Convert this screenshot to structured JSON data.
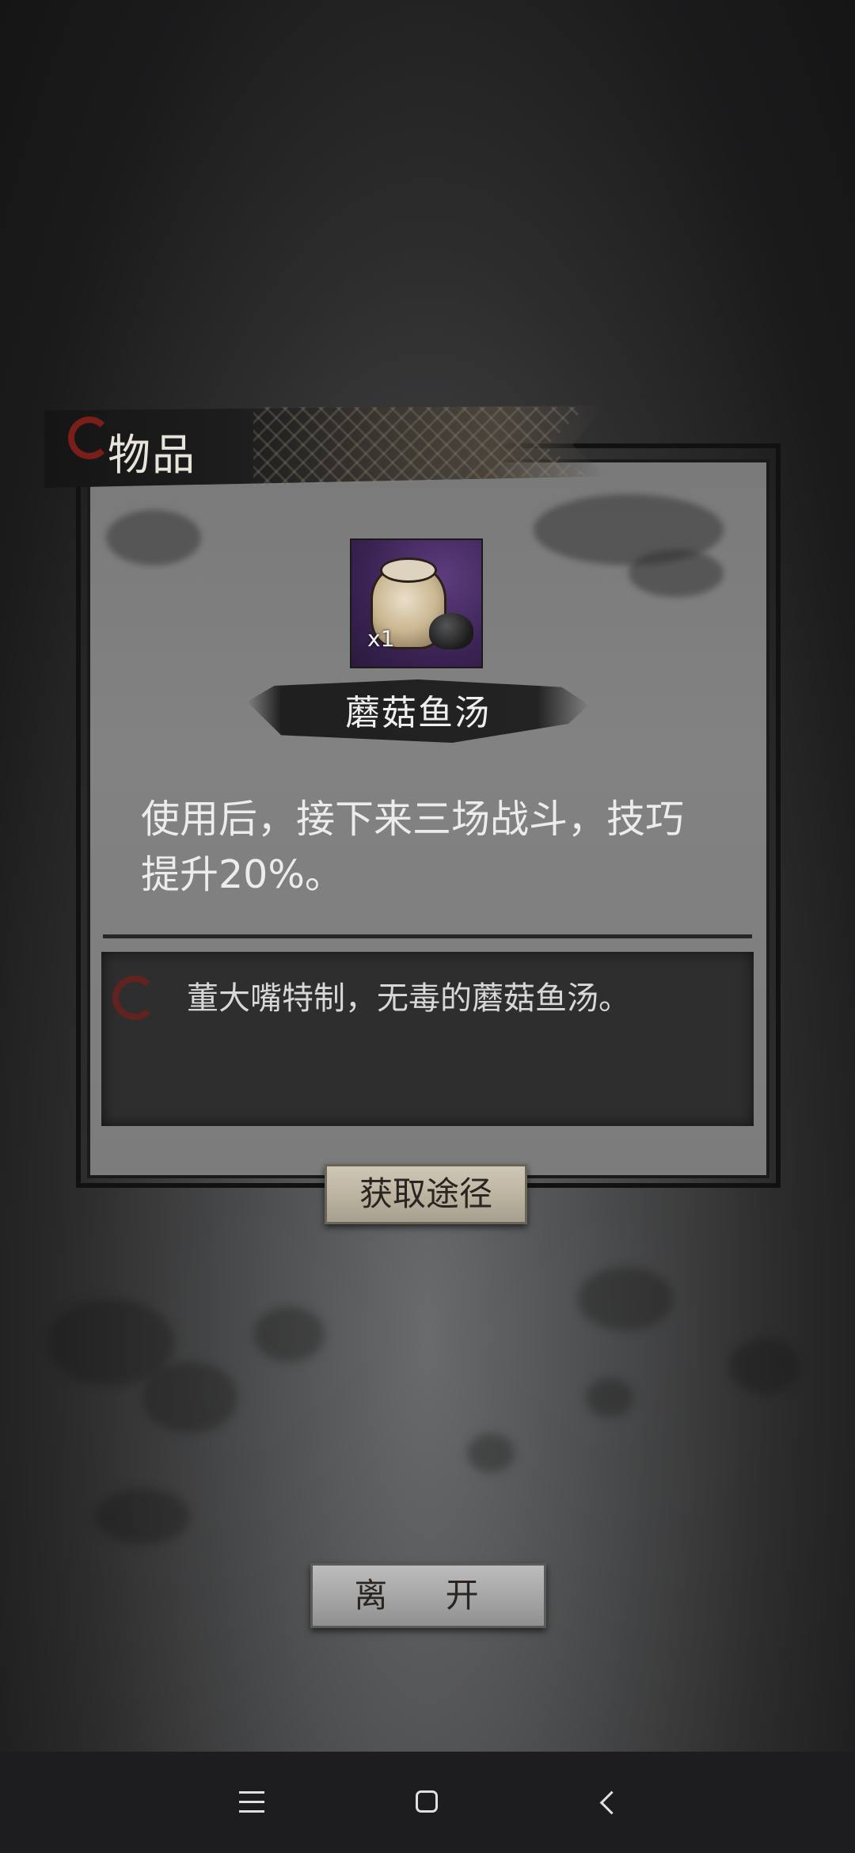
{
  "header": {
    "title": "物品"
  },
  "item": {
    "name": "蘑菇鱼汤",
    "count": "x1",
    "description": "使用后，接下来三场战斗，技巧提升20%。",
    "flavor_text": "董大嘴特制，无毒的蘑菇鱼汤。",
    "icon": "mushroom-fish-soup-jar-icon",
    "rarity_color": "#3b2354"
  },
  "buttons": {
    "source": "获取途径",
    "leave": "离 开"
  },
  "navbar": {
    "menu_icon": "menu-icon",
    "home_icon": "home-icon",
    "back_icon": "back-icon"
  }
}
